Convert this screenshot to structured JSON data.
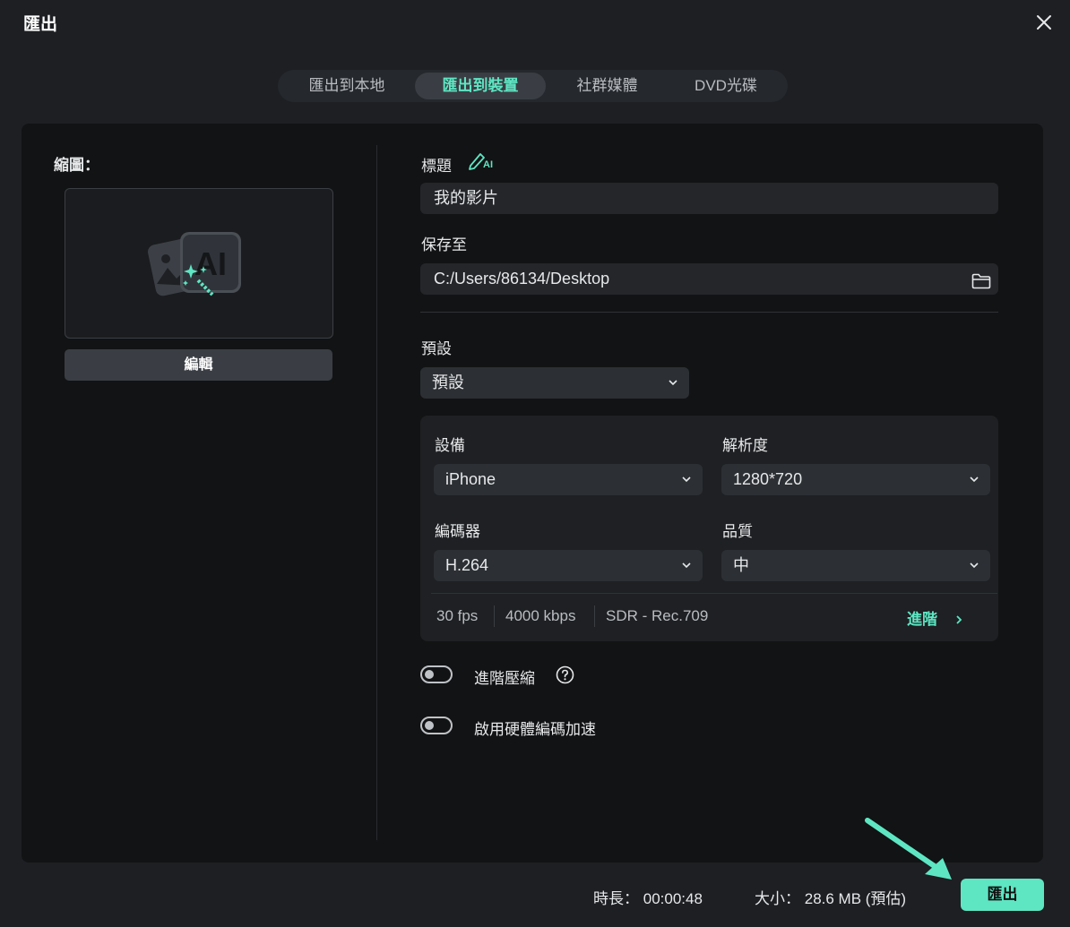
{
  "window": {
    "title": "匯出"
  },
  "tabs": [
    {
      "label": "匯出到本地"
    },
    {
      "label": "匯出到裝置"
    },
    {
      "label": "社群媒體"
    },
    {
      "label": "DVD光碟"
    }
  ],
  "active_tab": "匯出到裝置",
  "thumbnail": {
    "label": "縮圖：",
    "ai_text": "AI",
    "edit_label": "編輯"
  },
  "title_field": {
    "label": "標題",
    "ai_icon_text": "AI",
    "value": "我的影片"
  },
  "save_to": {
    "label": "保存至",
    "value": "C:/Users/86134/Desktop"
  },
  "preset": {
    "label": "預設",
    "value": "預設"
  },
  "settings": {
    "device": {
      "label": "設備",
      "value": "iPhone"
    },
    "resolution": {
      "label": "解析度",
      "value": "1280*720"
    },
    "encoder": {
      "label": "編碼器",
      "value": "H.264"
    },
    "quality": {
      "label": "品質",
      "value": "中"
    },
    "fps": "30 fps",
    "bitrate": "4000 kbps",
    "color": "SDR - Rec.709",
    "advanced_label": "進階"
  },
  "toggles": {
    "advanced_compression": {
      "label": "進階壓縮",
      "on": false
    },
    "hw_acceleration": {
      "label": "啟用硬體編碼加速",
      "on": false
    }
  },
  "footer": {
    "duration_label": "時長：",
    "duration_value": "00:00:48",
    "size_label": "大小：",
    "size_value": "28.6 MB (預估)",
    "export_label": "匯出"
  },
  "colors": {
    "accent": "#5ee6c3",
    "background": "#1d1f23",
    "panel": "#121314"
  }
}
